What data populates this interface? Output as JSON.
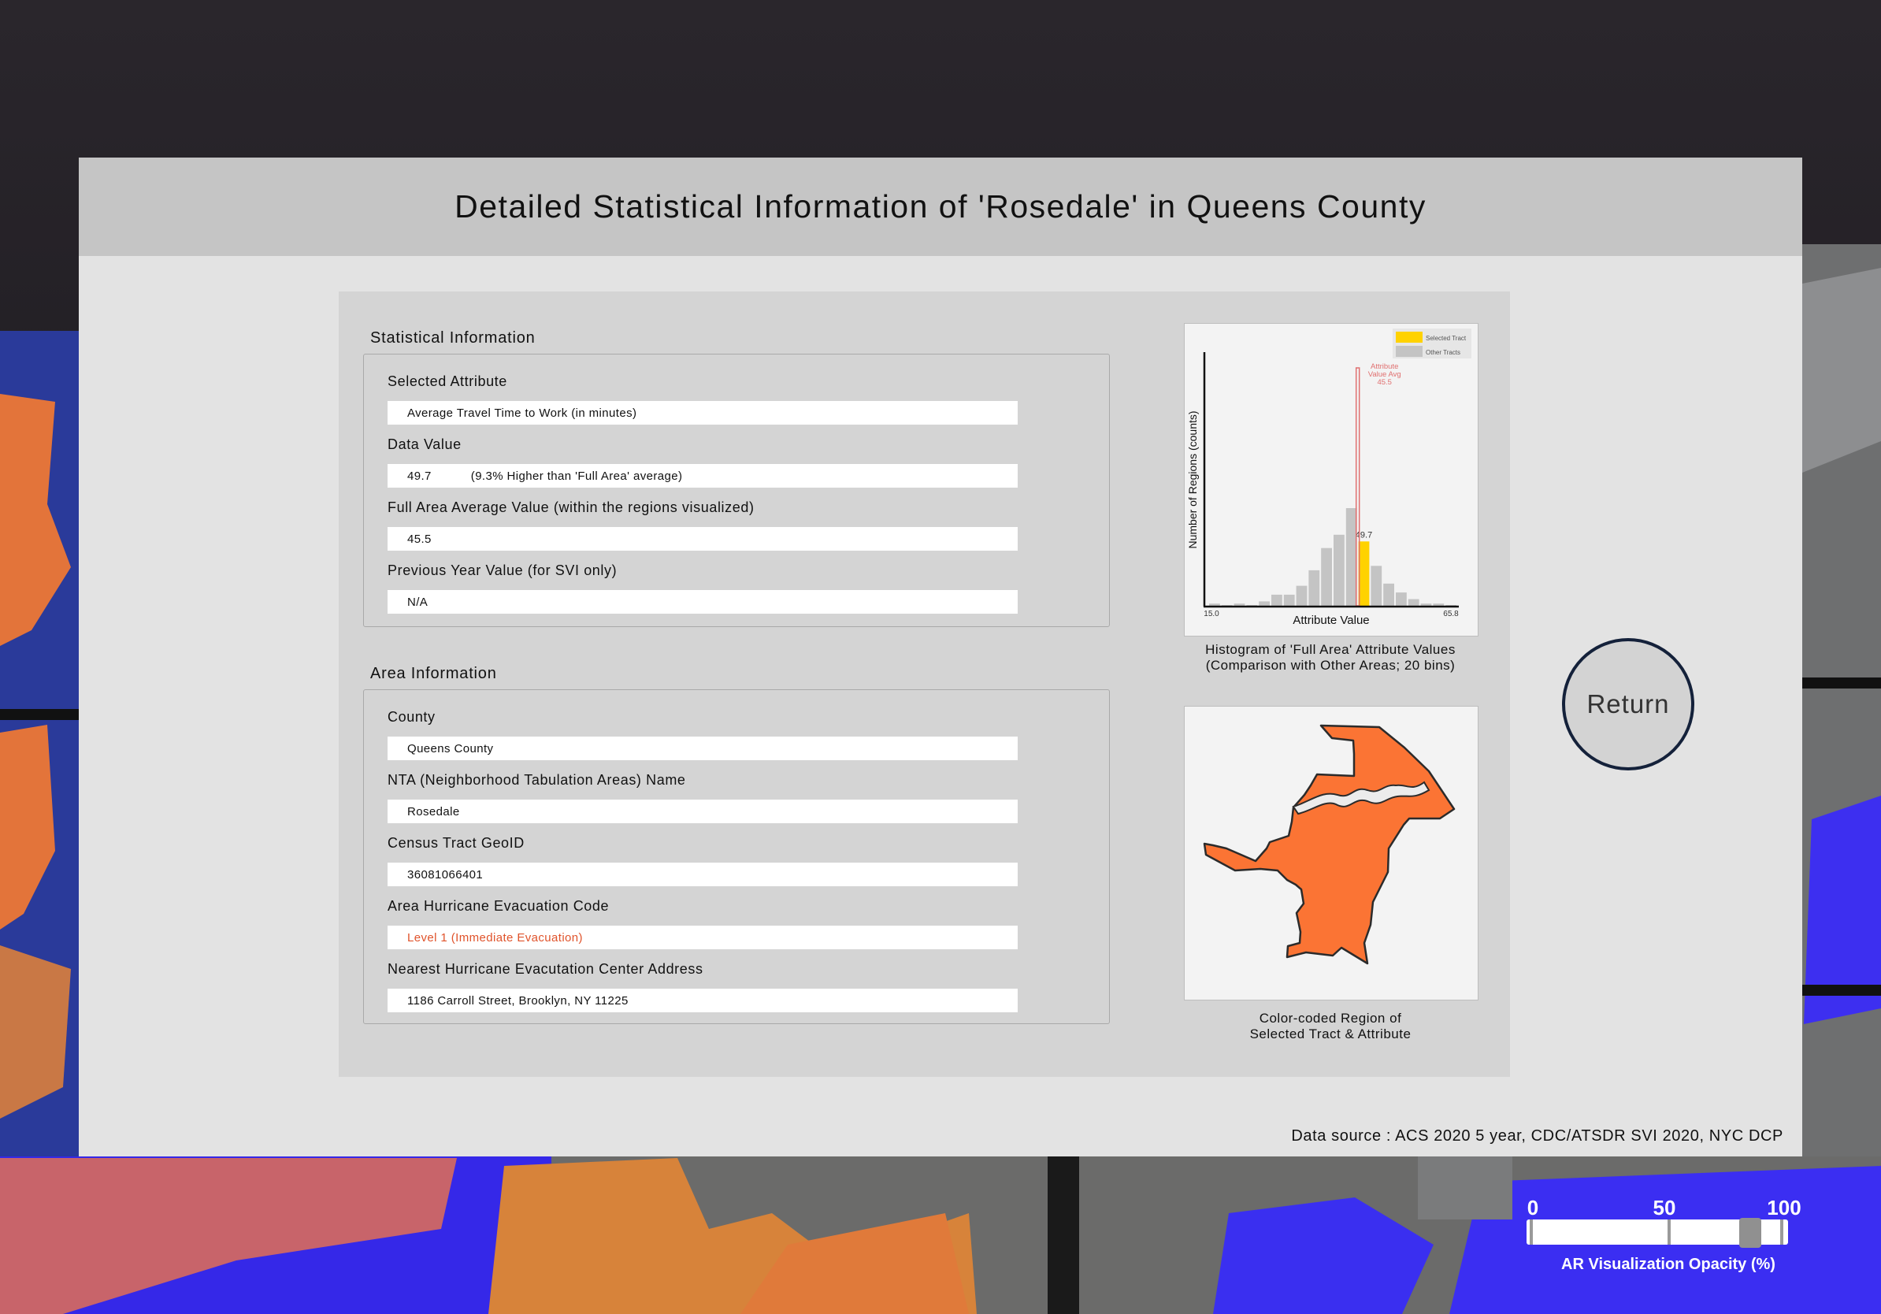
{
  "panel": {
    "title": "Detailed Statistical Information of 'Rosedale' in Queens County",
    "data_source": "Data source : ACS 2020 5 year, CDC/ATSDR SVI 2020, NYC DCP"
  },
  "statistical_info": {
    "section_title": "Statistical Information",
    "fields": [
      {
        "label": "Selected Attribute",
        "value": "Average Travel Time to Work (in minutes)"
      },
      {
        "label": "Data Value",
        "value": "49.7",
        "extra": "(9.3% Higher than 'Full Area' average)"
      },
      {
        "label": "Full Area Average Value (within the regions visualized)",
        "value": "45.5"
      },
      {
        "label": "Previous Year Value (for SVI only)",
        "value": "N/A"
      }
    ]
  },
  "area_info": {
    "section_title": "Area Information",
    "fields": [
      {
        "label": "County",
        "value": "Queens County"
      },
      {
        "label": "NTA (Neighborhood Tabulation Areas) Name",
        "value": "Rosedale"
      },
      {
        "label": "Census Tract GeoID",
        "value": "36081066401"
      },
      {
        "label": "Area Hurricane Evacuation Code",
        "value": "Level 1 (Immediate Evacuation)"
      },
      {
        "label": "Nearest Hurricane Evacutation Center Address",
        "value": "1186 Carroll Street, Brooklyn, NY 11225"
      }
    ],
    "alert_color": "#e0532b"
  },
  "chart_data": {
    "type": "bar",
    "title": "",
    "xlabel": "Attribute Value",
    "ylabel": "Number of Regions (counts)",
    "xlim": [
      15.0,
      65.8
    ],
    "x_tick_labels": [
      "15.0",
      "65.8"
    ],
    "bins": 20,
    "counts": [
      1,
      0,
      1,
      0,
      2,
      5,
      5,
      9,
      16,
      26,
      32,
      44,
      29,
      18,
      10,
      6,
      3,
      1,
      1,
      0
    ],
    "selected_bin": 12,
    "selected_value_label": "49.7",
    "average": 45.5,
    "average_label": [
      "Attribute",
      "Value Avg",
      "45.5"
    ],
    "legend": [
      {
        "name": "Selected Tract",
        "color": "#ffd200"
      },
      {
        "name": "Other Tracts",
        "color": "#c4c4c4"
      }
    ],
    "legend_position": "top-right",
    "avg_line_color": "#e07070",
    "grid": false
  },
  "histogram_caption": [
    "Histogram of 'Full Area' Attribute Values",
    "(Comparison with Other Areas; 20 bins)"
  ],
  "map_figure": {
    "caption": [
      "Color-coded Region of",
      "Selected Tract & Attribute"
    ],
    "region_color": "#fb7434"
  },
  "return_button": {
    "label": "Return"
  },
  "opacity_slider": {
    "ticks": [
      "0",
      "50",
      "100"
    ],
    "value": 87,
    "caption": "AR Visualization Opacity (%)"
  }
}
